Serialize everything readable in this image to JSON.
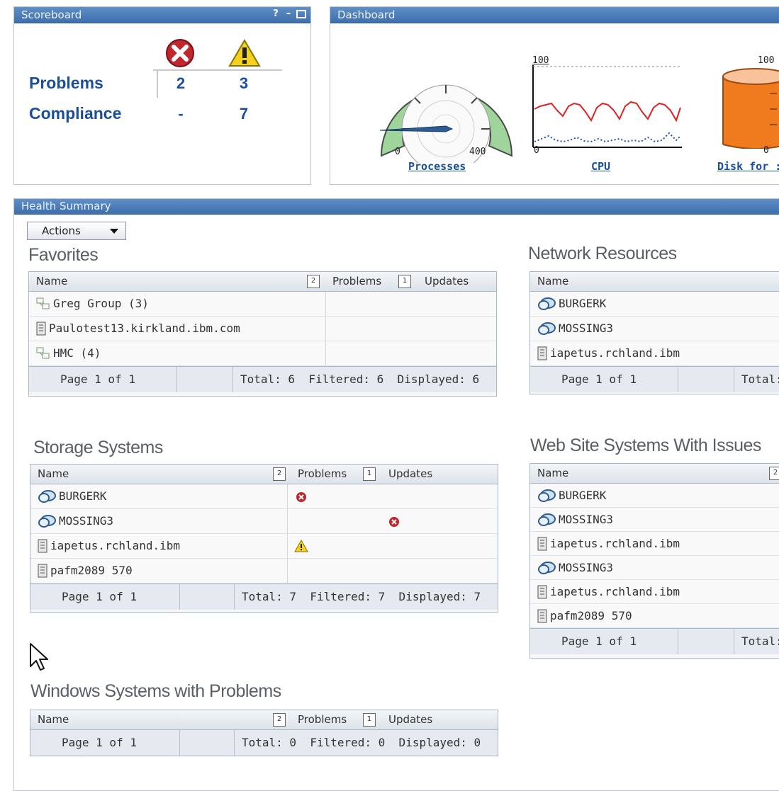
{
  "scoreboard": {
    "title": "Scoreboard",
    "ctrl_help": "?",
    "ctrl_min": "–",
    "rows": [
      {
        "label": "Problems",
        "critical": "2",
        "warning": "3"
      },
      {
        "label": "Compliance",
        "critical": "-",
        "warning": "7"
      }
    ]
  },
  "dashboard": {
    "title": "Dashboard",
    "processes": {
      "link": "Processes",
      "min": "0",
      "max": "400"
    },
    "cpu": {
      "link": "CPU",
      "min": "0",
      "max": "100"
    },
    "disk": {
      "link": "Disk for :",
      "min": "0",
      "max": "100"
    }
  },
  "health": {
    "title": "Health Summary",
    "actions_label": "Actions",
    "header": {
      "name": "Name",
      "problems": "Problems",
      "updates": "Updates",
      "sort_problems": "2",
      "sort_updates": "1"
    },
    "favorites": {
      "title": "Favorites",
      "rows": [
        {
          "name": "Greg Group (3)",
          "icon": "group-icon"
        },
        {
          "name": "Paulotest13.kirkland.ibm.com",
          "icon": "server-icon"
        },
        {
          "name": "HMC (4)",
          "icon": "group-icon"
        }
      ],
      "footer": {
        "page": "Page 1 of 1",
        "totals": "Total: 6  Filtered: 6  Displayed: 6"
      }
    },
    "network": {
      "title": "Network Resources",
      "rows": [
        {
          "name": "BURGERK",
          "icon": "system-icon"
        },
        {
          "name": "MOSSING3",
          "icon": "system-icon"
        },
        {
          "name": "iapetus.rchland.ibm",
          "icon": "server-icon"
        }
      ],
      "footer": {
        "page": "Page 1 of 1",
        "totals": "Total:"
      }
    },
    "storage": {
      "title": "Storage Systems",
      "rows": [
        {
          "name": "BURGERK",
          "icon": "system-icon",
          "status": "critical-problem"
        },
        {
          "name": "MOSSING3",
          "icon": "system-icon",
          "status": "critical-update"
        },
        {
          "name": "iapetus.rchland.ibm",
          "icon": "server-icon",
          "status": "warning-problem"
        },
        {
          "name": "pafm2089 570",
          "icon": "server-icon",
          "status": ""
        }
      ],
      "footer": {
        "page": "Page 1 of 1",
        "totals": "Total: 7  Filtered: 7  Displayed: 7"
      }
    },
    "websites": {
      "title": "Web Site Systems With Issues",
      "rows": [
        {
          "name": "BURGERK",
          "icon": "system-icon"
        },
        {
          "name": "MOSSING3",
          "icon": "system-icon"
        },
        {
          "name": "iapetus.rchland.ibm",
          "icon": "server-icon"
        },
        {
          "name": "MOSSING3",
          "icon": "system-icon"
        },
        {
          "name": "iapetus.rchland.ibm",
          "icon": "server-icon"
        },
        {
          "name": "pafm2089 570",
          "icon": "server-icon"
        }
      ],
      "footer": {
        "page": "Page 1 of 1",
        "totals": "Total:"
      }
    },
    "windows": {
      "title": "Windows Systems with Problems",
      "footer": {
        "page": "Page 1 of 1",
        "totals": "Total: 0  Filtered: 0  Displayed: 0"
      }
    }
  },
  "colors": {
    "title_bar": "#4a7bb8",
    "link": "#1a4f9a",
    "critical": "#c0262d",
    "warning": "#f3d21f",
    "gauge_green": "#9fd59a",
    "disk_orange": "#f07a1e"
  }
}
